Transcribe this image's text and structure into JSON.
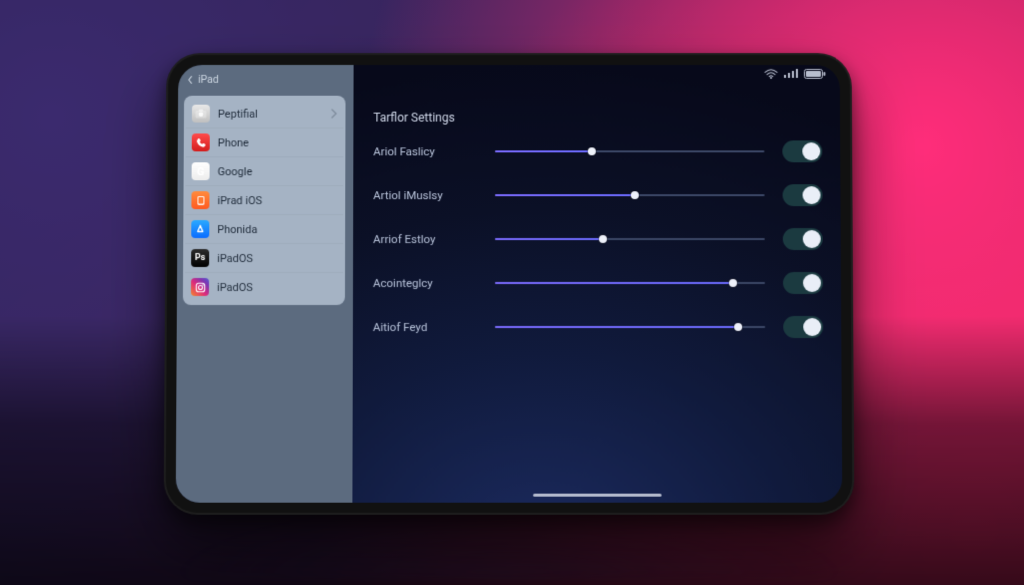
{
  "status": {
    "wifi": true,
    "signal": true,
    "battery_pct": 95
  },
  "sidebar": {
    "back_label": "iPad",
    "items": [
      {
        "label": "Peptifial"
      },
      {
        "label": "Phone"
      },
      {
        "label": "Google"
      },
      {
        "label": "iPrad iOS"
      },
      {
        "label": "Phonida"
      },
      {
        "label": "iPadOS"
      },
      {
        "label": "iPadOS"
      }
    ]
  },
  "detail": {
    "section_title": "Tarflor Settings",
    "rows": [
      {
        "label": "Ariol Faslicy",
        "slider_pct": 36,
        "toggle_on": true
      },
      {
        "label": "Artiol iMuslsy",
        "slider_pct": 52,
        "toggle_on": true
      },
      {
        "label": "Arriof Estloy",
        "slider_pct": 40,
        "toggle_on": true
      },
      {
        "label": "Acointeglcy",
        "slider_pct": 88,
        "toggle_on": true
      },
      {
        "label": "Aitiof Feyd",
        "slider_pct": 90,
        "toggle_on": true
      }
    ]
  },
  "colors": {
    "accent": "#6b6bff",
    "sidebar_bg": "#5c6b7f",
    "sidebar_panel": "#a5b3c4"
  }
}
